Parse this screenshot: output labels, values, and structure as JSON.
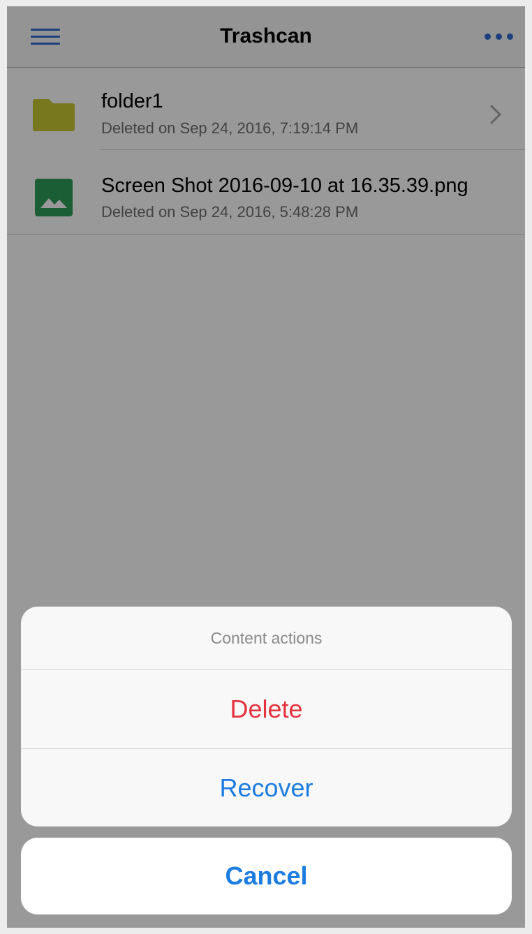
{
  "navbar": {
    "title": "Trashcan",
    "menu_icon": "hamburger-menu-icon",
    "more_icon": "ellipsis-icon"
  },
  "items": [
    {
      "name": "folder1",
      "subtitle": "Deleted on Sep 24, 2016, 7:19:14 PM",
      "icon": "folder-icon",
      "has_disclosure": true
    },
    {
      "name": "Screen Shot 2016-09-10 at 16.35.39.png",
      "subtitle": "Deleted on Sep 24, 2016, 5:48:28 PM",
      "icon": "image-file-icon",
      "has_disclosure": false
    }
  ],
  "action_sheet": {
    "title": "Content actions",
    "delete_label": "Delete",
    "recover_label": "Recover",
    "cancel_label": "Cancel"
  },
  "colors": {
    "accent": "#2f6bd1",
    "action_blue": "#1d7ce0",
    "destructive": "#e5323f",
    "folder": "#c8c832",
    "image_icon": "#2e9b58"
  }
}
